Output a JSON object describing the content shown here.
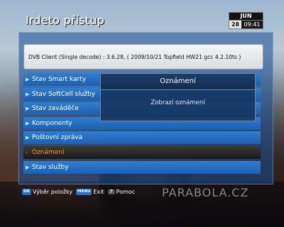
{
  "header": {
    "title": "Irdeto přístup",
    "clock": {
      "month": "JUN",
      "day": "28",
      "time": "09:41"
    }
  },
  "info": {
    "text": "DVB Client (Single decode) : 3.6.28, ( 2009/10/21 Topfield HW21 gcc 4.2.10ts )"
  },
  "menu": {
    "items": [
      {
        "label": "Stav Smart karty",
        "selected": false
      },
      {
        "label": "Stav SoftCell služby",
        "selected": false
      },
      {
        "label": "Stav zaváděče",
        "selected": false
      },
      {
        "label": "Komponenty",
        "selected": false
      },
      {
        "label": "Poštovní zpráva",
        "selected": false
      },
      {
        "label": "Oznámení",
        "selected": true
      },
      {
        "label": "Stav služby",
        "selected": false
      }
    ]
  },
  "popup": {
    "title": "Oznámení",
    "message": "Zobrazí oznámení"
  },
  "footer": {
    "hints": [
      {
        "key": "OK",
        "label": "Výběr položky"
      },
      {
        "key": "MENU",
        "label": "Exit"
      },
      {
        "key": "?",
        "label": "Pomoc"
      }
    ],
    "watermark": "PARABOLA.CZ"
  },
  "colors": {
    "menu_item": "#2f7fd2",
    "selected_text": "#f0a030",
    "popup_bg": "#16345c"
  }
}
